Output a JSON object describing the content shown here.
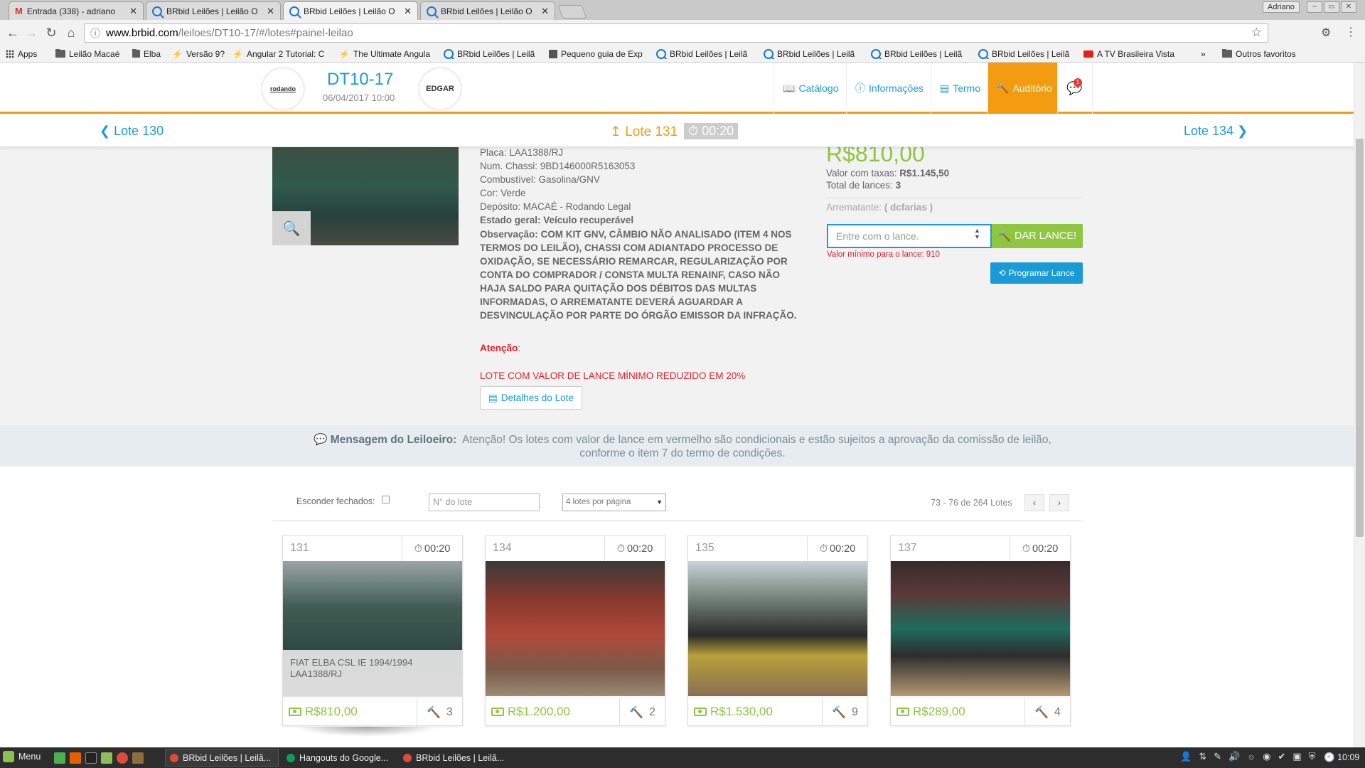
{
  "browser": {
    "tabs": [
      {
        "title": "Entrada (338) - adriano",
        "icon": "gmail-icon"
      },
      {
        "title": "BRbid Leilões | Leilão O",
        "icon": "brbid-icon"
      },
      {
        "title": "BRbid Leilões | Leilão O",
        "icon": "brbid-icon",
        "active": true
      },
      {
        "title": "BRbid Leilões | Leilão O",
        "icon": "brbid-icon"
      }
    ],
    "profile": "Adriano",
    "url_host": "www.brbid.com",
    "url_path": "/leiloes/DT10-17/#/lotes#painel-leilao",
    "bookmarks": [
      "Apps",
      "Leilão Macaé",
      "Elba",
      "Versão 9?",
      "Angular 2 Tutorial: C",
      "The Ultimate Angula",
      "BRbid Leilões | Leilã",
      "Pequeno guia de Exp",
      "BRbid Leilões | Leilã",
      "BRbid Leilões | Leilã",
      "BRbid Leilões | Leilã",
      "BRbid Leilões | Leilã",
      "A TV Brasileira Vista"
    ],
    "bookmarks_more": "»",
    "other_bookmarks": "Outros favoritos"
  },
  "header": {
    "logo_left": "rodando",
    "logo_right": "EDGAR",
    "auction_code": "DT10-17",
    "auction_date": "06/04/2017 10:00",
    "nav": [
      "Catálogo",
      "Informações",
      "Termo",
      "Auditório"
    ],
    "chat_badge": "1"
  },
  "lot_nav": {
    "prev": "Lote 130",
    "current": "Lote 131",
    "timer": "00:20",
    "next": "Lote 134"
  },
  "lot": {
    "specs": [
      {
        "label": "Placa: ",
        "value": "LAA1388/RJ"
      },
      {
        "label": "Num. Chassi: ",
        "value": "9BD146000R5163053"
      },
      {
        "label": "Combustível: ",
        "value": "Gasolina/GNV"
      },
      {
        "label": "Cor: ",
        "value": "Verde"
      },
      {
        "label": "Depósito: ",
        "value": "MACAÉ - Rodando Legal"
      }
    ],
    "estado_label": "Estado geral: ",
    "estado_value": "Veículo recuperável",
    "observacao": "Observação: COM KIT GNV, CÂMBIO NÃO ANALISADO (ITEM 4 NOS TERMOS DO LEILÃO), CHASSI COM ADIANTADO PROCESSO DE OXIDAÇÃO, SE NECESSÁRIO REMARCAR, REGULARIZAÇÃO POR CONTA DO COMPRADOR / CONSTA MULTA RENAINF, CASO NÃO HAJA SALDO PARA QUITAÇÃO DOS DÉBITOS DAS MULTAS INFORMADAS, O ARREMATANTE DEVERÁ AGUARDAR A DESVINCULAÇÃO POR PARTE DO ÓRGÃO EMISSOR DA INFRAÇÃO.",
    "atencao": "Atenção",
    "reduced_notice": "LOTE COM VALOR DE LANCE MÍNIMO REDUZIDO EM 20%",
    "details_button": "Detalhes do Lote",
    "price": "R$810,00",
    "tax_label": "Valor com taxas: ",
    "tax_value": "R$1.145,50",
    "bids_label": "Total de lances: ",
    "bids_value": "3",
    "winner_label": "Arrematante: ",
    "winner_value": "( dcfarias )",
    "bid_placeholder": "Entre com o lance.",
    "bid_button": "DAR LANCE!",
    "min_bid": "Valor mínimo para o lance: 910",
    "schedule_button": "Programar Lance"
  },
  "message": {
    "label": "Mensagem do Leiloeiro:",
    "text": "Atenção! Os lotes com valor de lance em vermelho são condicionais e estão sujeitos a aprovação da comissão de leilão, conforme o item 7 do termo de condições."
  },
  "filters": {
    "hide_closed": "Esconder fechados:",
    "lot_placeholder": "N° do lote",
    "per_page": "4 lotes por página",
    "page_info": "73 - 76 de 264 Lotes",
    "prev": "‹",
    "next": "›"
  },
  "cards": [
    {
      "num": "131",
      "time": "00:20",
      "price": "R$810,00",
      "bids": "3",
      "caption1": "FIAT ELBA CSL IE 1994/1994",
      "caption2": "LAA1388/RJ"
    },
    {
      "num": "134",
      "time": "00:20",
      "price": "R$1.200,00",
      "bids": "2"
    },
    {
      "num": "135",
      "time": "00:20",
      "price": "R$1.530,00",
      "bids": "9"
    },
    {
      "num": "137",
      "time": "00:20",
      "price": "R$289,00",
      "bids": "4"
    }
  ],
  "taskbar": {
    "menu": "Menu",
    "tasks": [
      "BRbid Leilões | Leilã...",
      "Hangouts do Google...",
      "BRbid Leilões | Leilã..."
    ],
    "clock": "10:09"
  }
}
